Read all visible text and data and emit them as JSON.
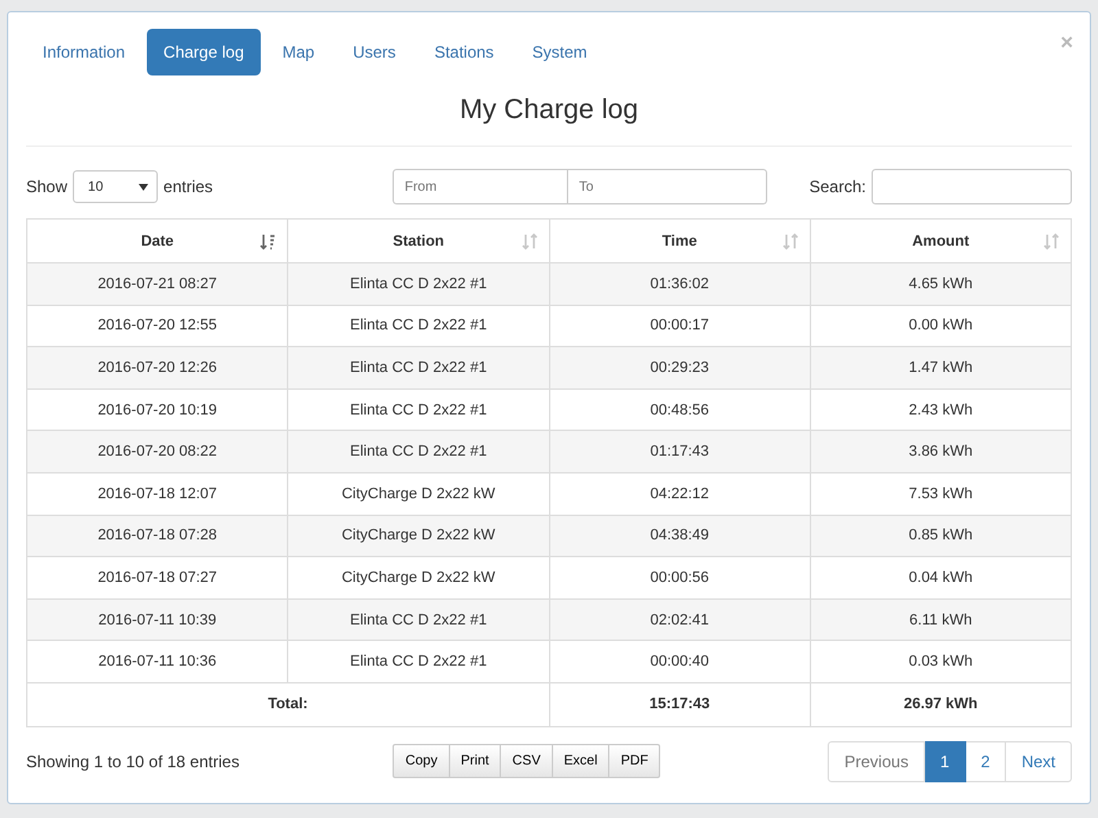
{
  "tabs": [
    {
      "label": "Information",
      "selected": false
    },
    {
      "label": "Charge log",
      "selected": true
    },
    {
      "label": "Map",
      "selected": false
    },
    {
      "label": "Users",
      "selected": false
    },
    {
      "label": "Stations",
      "selected": false
    },
    {
      "label": "System",
      "selected": false
    }
  ],
  "close": "×",
  "title": "My Charge log",
  "length": {
    "label_before": "Show",
    "value": "10",
    "label_after": "entries"
  },
  "date_range": {
    "from_placeholder": "From",
    "to_placeholder": "To"
  },
  "search": {
    "label": "Search:"
  },
  "table": {
    "columns": [
      {
        "label": "Date",
        "sorted": true
      },
      {
        "label": "Station",
        "sorted": false
      },
      {
        "label": "Time",
        "sorted": false
      },
      {
        "label": "Amount",
        "sorted": false
      }
    ],
    "rows": [
      [
        "2016-07-21 08:27",
        "Elinta CC D 2x22 #1",
        "01:36:02",
        "4.65 kWh"
      ],
      [
        "2016-07-20 12:55",
        "Elinta CC D 2x22 #1",
        "00:00:17",
        "0.00 kWh"
      ],
      [
        "2016-07-20 12:26",
        "Elinta CC D 2x22 #1",
        "00:29:23",
        "1.47 kWh"
      ],
      [
        "2016-07-20 10:19",
        "Elinta CC D 2x22 #1",
        "00:48:56",
        "2.43 kWh"
      ],
      [
        "2016-07-20 08:22",
        "Elinta CC D 2x22 #1",
        "01:17:43",
        "3.86 kWh"
      ],
      [
        "2016-07-18 12:07",
        "CityCharge D 2x22 kW",
        "04:22:12",
        "7.53 kWh"
      ],
      [
        "2016-07-18 07:28",
        "CityCharge D 2x22 kW",
        "04:38:49",
        "0.85 kWh"
      ],
      [
        "2016-07-18 07:27",
        "CityCharge D 2x22 kW",
        "00:00:56",
        "0.04 kWh"
      ],
      [
        "2016-07-11 10:39",
        "Elinta CC D 2x22 #1",
        "02:02:41",
        "6.11 kWh"
      ],
      [
        "2016-07-11 10:36",
        "Elinta CC D 2x22 #1",
        "00:00:40",
        "0.03 kWh"
      ]
    ],
    "footer": {
      "label": "Total:",
      "time": "15:17:43",
      "amount": "26.97 kWh"
    }
  },
  "info": "Showing 1 to 10 of 18 entries",
  "export_buttons": [
    "Copy",
    "Print",
    "CSV",
    "Excel",
    "PDF"
  ],
  "pagination": {
    "previous": "Previous",
    "pages": [
      {
        "label": "1",
        "selected": true
      },
      {
        "label": "2",
        "selected": false
      }
    ],
    "next": "Next"
  }
}
